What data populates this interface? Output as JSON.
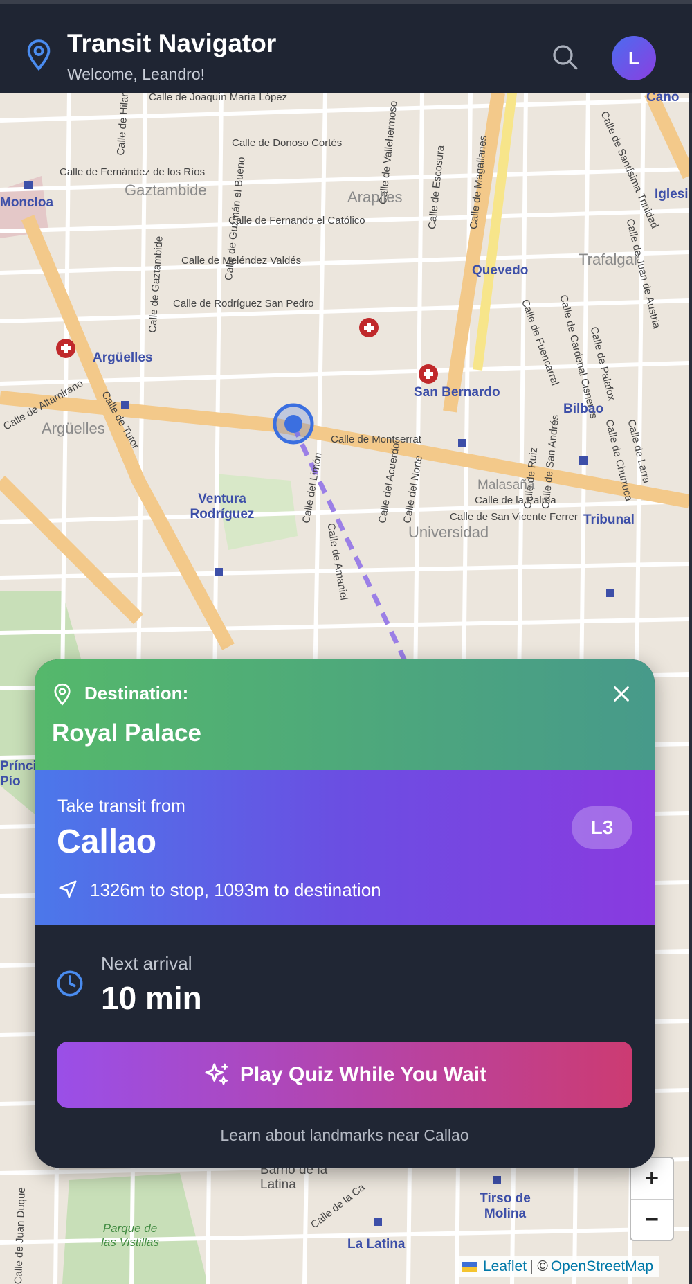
{
  "header": {
    "title": "Transit Navigator",
    "subtitle": "Welcome, Leandro!",
    "avatar_initial": "L"
  },
  "map": {
    "streets": [
      "Calle de Joaquín María López",
      "Calle de Donoso Cortés",
      "Calle de Fernández de los Ríos",
      "Calle de Fernando el Católico",
      "Calle de Meléndez Valdés",
      "Calle de Rodríguez San Pedro",
      "Calle de Montserrat",
      "Calle de la Palma",
      "Calle de San Vicente Ferrer",
      "Calle de Vallehermoso",
      "Calle de Guzmán el Bueno",
      "Calle de Escosura",
      "Calle de Magallanes",
      "Calle de Fuencarral",
      "Calle de Tutor",
      "Calle del Limón",
      "Calle de Amaniel",
      "Calle del Acuerdo",
      "Calle del Norte",
      "Calle de Altamirano",
      "Calle de Gaztambide",
      "Calle de Hilarión Eslava",
      "Calle de Santísima Trinidad",
      "Calle de Juan de Austria",
      "Calle de Cardenal Cisneros",
      "Calle de Palafox",
      "Calle de San Andrés",
      "Calle de Ruiz",
      "Calle de Churruca",
      "Calle de Larra",
      "Calle de Juan Duque",
      "Calle de la Ca"
    ],
    "districts": [
      "Gaztambide",
      "Arapiles",
      "Trafalgar",
      "Argüelles",
      "Universidad",
      "Malasaña",
      "Barrio de la Latina"
    ],
    "stations": [
      "Moncloa",
      "Argüelles",
      "Quevedo",
      "San Bernardo",
      "Bilbao",
      "Ventura Rodríguez",
      "Tribunal",
      "Tirso de Molina",
      "La Latina",
      "Iglesia",
      "Alonso Cano",
      "Príncipe Pío"
    ],
    "parks": [
      "Parque de las Vistillas"
    ],
    "zoom_in": "+",
    "zoom_out": "−",
    "attribution": {
      "leaflet": "Leaflet",
      "separator": "| ©",
      "osm": "OpenStreetMap"
    },
    "route_color": "#9b7fe6",
    "location_color": "#3b6fe0"
  },
  "card": {
    "destination_label": "Destination:",
    "destination_name": "Royal Palace",
    "transit_from_label": "Take transit from",
    "stop_name": "Callao",
    "line_badge": "L3",
    "distance_text": "1326m to stop, 1093m to destination",
    "next_arrival_label": "Next arrival",
    "next_arrival_value": "10 min",
    "quiz_button": "Play Quiz While You Wait",
    "hint": "Learn about landmarks near Callao"
  },
  "colors": {
    "header_bg": "#1f2533",
    "dest_gradient": [
      "#55b86b",
      "#479a8a"
    ],
    "transit_gradient": [
      "#4b78ea",
      "#8a3ae0"
    ],
    "quiz_gradient": [
      "#9a4fe8",
      "#cc3b72"
    ]
  },
  "icons": [
    "location-pin-icon",
    "search-icon",
    "close-icon",
    "navigation-arrow-icon",
    "clock-icon",
    "sparkles-icon",
    "hospital-icon",
    "metro-icon"
  ]
}
